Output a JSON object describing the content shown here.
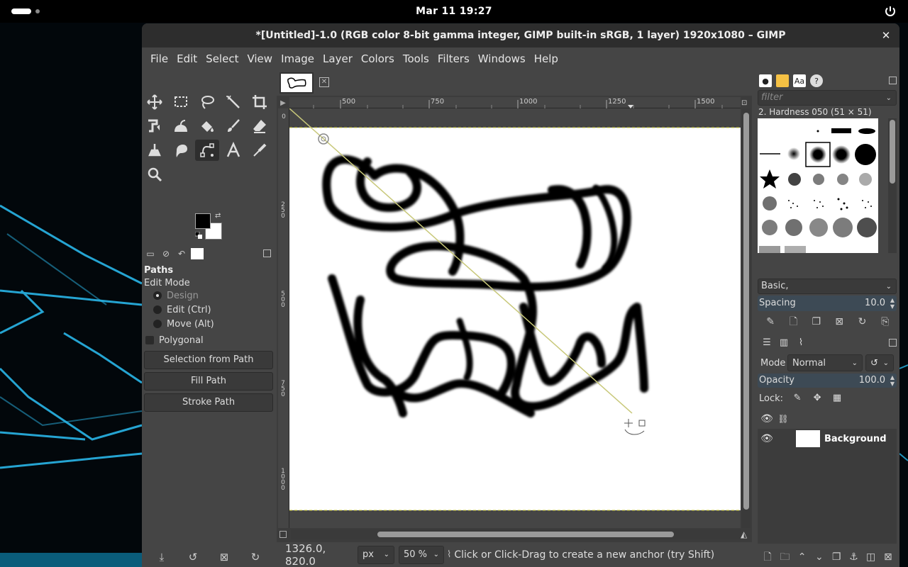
{
  "topbar": {
    "clock": "Mar 11  19:27"
  },
  "window": {
    "title": "*[Untitled]-1.0 (RGB color 8-bit gamma integer, GIMP built-in sRGB, 1 layer) 1920x1080 – GIMP",
    "close": "✕"
  },
  "menu": [
    "File",
    "Edit",
    "Select",
    "View",
    "Image",
    "Layer",
    "Colors",
    "Tools",
    "Filters",
    "Windows",
    "Help"
  ],
  "colors": {
    "foreground": "#000000",
    "background": "#ffffff",
    "accent": "#3d4a55",
    "path_line": "#c8c87a"
  },
  "tool_options": {
    "title": "Paths",
    "edit_mode_label": "Edit Mode",
    "modes": [
      "Design",
      "Edit (Ctrl)",
      "Move (Alt)"
    ],
    "selected_mode": "Design",
    "polygonal_label": "Polygonal",
    "polygonal_checked": false,
    "selection_from_path": "Selection from Path",
    "fill_path": "Fill Path",
    "stroke_path": "Stroke Path"
  },
  "rulers": {
    "h": [
      "500",
      "750",
      "1000",
      "1250",
      "1500"
    ],
    "v": [
      "0",
      "250",
      "500",
      "750",
      "1000"
    ]
  },
  "status": {
    "coords": "1326.0, 820.0",
    "unit": "px",
    "zoom": "50 %",
    "message": "Click or Click-Drag to create a new anchor (try Shift)"
  },
  "brushes": {
    "filter_placeholder": "filter",
    "current_brush": "2. Hardness 050 (51 × 51)",
    "preset": "Basic,",
    "spacing_label": "Spacing",
    "spacing_value": "10.0"
  },
  "layers": {
    "mode_label": "Mode",
    "mode_value": "Normal",
    "opacity_label": "Opacity",
    "opacity_value": "100.0",
    "lock_label": "Lock:",
    "items": [
      {
        "name": "Background",
        "visible": true
      }
    ]
  }
}
